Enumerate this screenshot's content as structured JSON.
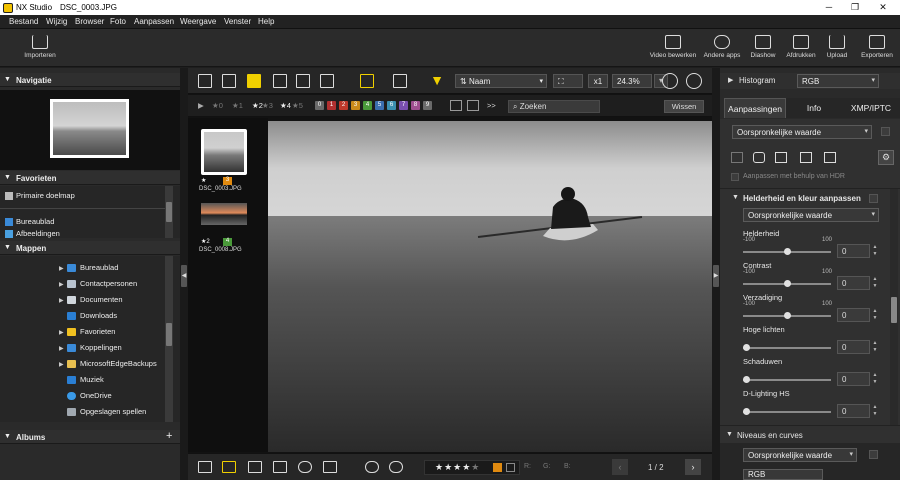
{
  "titlebar": {
    "app": "NX Studio",
    "file": "DSC_0003.JPG",
    "minimize": "─",
    "maximize": "❐",
    "close": "✕"
  },
  "menu": [
    "Bestand",
    "Wijzig",
    "Browser",
    "Foto",
    "Aanpassen",
    "Weergave",
    "Venster",
    "Help"
  ],
  "toolbar": {
    "import": "Importeren",
    "video": "Video bewerken",
    "apps": "Andere apps",
    "slideshow": "Diashow",
    "print": "Afdrukken",
    "upload": "Upload",
    "export": "Exporteren"
  },
  "left": {
    "nav_title": "Navigatie",
    "fav_title": "Favorieten",
    "favorites": [
      "Primaire doelmap",
      "Bureaublad",
      "Afbeeldingen"
    ],
    "folders_title": "Mappen",
    "folders": [
      "Bureaublad",
      "Contactpersonen",
      "Documenten",
      "Downloads",
      "Favorieten",
      "Koppelingen",
      "MicrosoftEdgeBackups",
      "Muziek",
      "OneDrive",
      "Opgeslagen spellen"
    ],
    "albums_title": "Albums",
    "albums_add": "+"
  },
  "center": {
    "sort_label": "Naam",
    "zoom_fit": "x1",
    "zoom_pct": "24.3%",
    "filter_stars": [
      "★0",
      "★1",
      "★2",
      "★3",
      "★4",
      "★5"
    ],
    "labels": [
      "0",
      "1",
      "2",
      "3",
      "4",
      "5",
      "6",
      "7",
      "8",
      "9"
    ],
    "label_colors": [
      "#6a6a6a",
      "#b03030",
      "#c0392b",
      "#c98a1a",
      "#4a9a3a",
      "#3b6fb0",
      "#3b8fb0",
      "#7a4fb0",
      "#a04f90",
      "#6a6a6a"
    ],
    "search_placeholder": "Zoeken",
    "clear": "Wissen",
    "more": ">>",
    "thumbs": [
      {
        "rating": "★",
        "file": "DSC_0003.JPG",
        "badge": "3"
      },
      {
        "rating": "★2",
        "file": "DSC_0008.JPG",
        "badge": "4"
      }
    ],
    "page": "1 / 2",
    "readout": {
      "r": "R:",
      "g": "G:",
      "b": "B:"
    }
  },
  "right": {
    "histogram_title": "Histogram",
    "histogram_mode": "RGB",
    "tabs": [
      "Aanpassingen",
      "Info",
      "XMP/IPTC"
    ],
    "preset": "Oorspronkelijke waarde",
    "hdr": "Aanpassen met behulp van HDR",
    "section1": "Helderheid en kleur aanpassen",
    "section1_preset": "Oorspronkelijke waarde",
    "sliders": [
      {
        "name": "Helderheid",
        "min": "-100",
        "max": "100",
        "value": "0",
        "level": 0.5
      },
      {
        "name": "Contrast",
        "min": "-100",
        "max": "100",
        "value": "0",
        "level": 0.5
      },
      {
        "name": "Verzadiging",
        "min": "-100",
        "max": "100",
        "value": "0",
        "level": 0.5
      },
      {
        "name": "Hoge lichten",
        "min": "",
        "max": "",
        "value": "0",
        "level": 0
      },
      {
        "name": "Schaduwen",
        "min": "",
        "max": "",
        "value": "0",
        "level": 0
      },
      {
        "name": "D-Lighting HS",
        "min": "",
        "max": "",
        "value": "0",
        "level": 0
      }
    ],
    "section2": "Niveaus en curves",
    "section2_preset": "Oorspronkelijke waarde",
    "section2_mode": "RGB"
  }
}
